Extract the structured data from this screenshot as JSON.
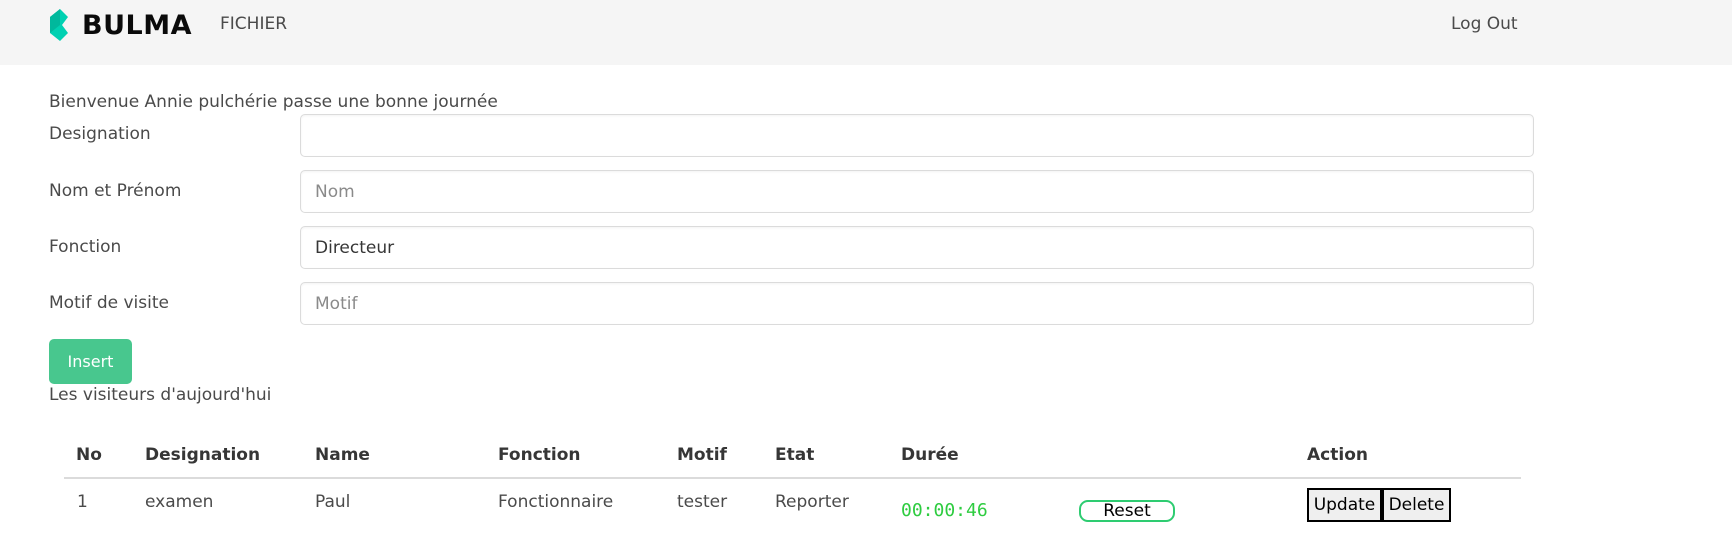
{
  "navbar": {
    "brand": "BULMA",
    "fichier": "FICHIER",
    "logout": "Log Out"
  },
  "welcome": "Bienvenue Annie pulchérie passe une bonne journée",
  "form": {
    "designation": {
      "label": "Designation",
      "value": "",
      "placeholder": ""
    },
    "nom": {
      "label": "Nom et Prénom",
      "value": "",
      "placeholder": "Nom"
    },
    "fonction": {
      "label": "Fonction",
      "value": "Directeur",
      "placeholder": ""
    },
    "motif": {
      "label": "Motif de visite",
      "value": "",
      "placeholder": "Motif"
    },
    "insert_label": "Insert"
  },
  "table": {
    "title": "Les visiteurs d'aujourd'hui",
    "headers": {
      "no": "No",
      "designation": "Designation",
      "name": "Name",
      "fonction": "Fonction",
      "motif": "Motif",
      "etat": "Etat",
      "duree": "Durée",
      "action": "Action"
    },
    "rows": [
      {
        "no": "1",
        "designation": "examen",
        "name": "Paul",
        "fonction": "Fonctionnaire",
        "motif": "tester",
        "etat": "Reporter",
        "duree": "00:00:46",
        "reset": "Reset",
        "update": "Update",
        "delete": "Delete"
      }
    ]
  },
  "colors": {
    "brand": "#00d1b2",
    "navbar_bg": "#f5f5f5",
    "insert_button": "#48c78e",
    "timer": "#2ecc40"
  },
  "icons": {
    "brand_logo": "bulma-logo"
  }
}
